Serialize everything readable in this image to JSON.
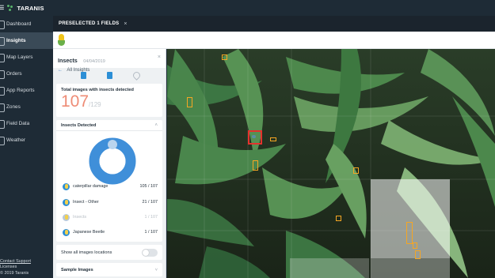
{
  "app": {
    "brand": "TARANIS"
  },
  "sidebar": {
    "items": [
      {
        "label": "Dashboard",
        "icon": "dashboard-icon"
      },
      {
        "label": "Insights",
        "icon": "insights-icon",
        "active": true
      },
      {
        "label": "Map Layers",
        "icon": "map-layers-icon"
      },
      {
        "label": "Orders",
        "icon": "orders-icon"
      },
      {
        "label": "App Reports",
        "icon": "app-reports-icon"
      },
      {
        "label": "Zones",
        "icon": "zones-icon"
      },
      {
        "label": "Field Data",
        "icon": "field-data-icon"
      },
      {
        "label": "Weather",
        "icon": "weather-icon"
      }
    ],
    "footer": {
      "contact": "Contact Support",
      "licenses": "Licenses",
      "copyright": "© 2019 Taranis"
    }
  },
  "topbar": {
    "title": "PRESELECTED 1 FIELDS",
    "close": "×"
  },
  "crop": {
    "icon": "corn-icon"
  },
  "panel": {
    "title": "Insects",
    "date": "04/04/2019",
    "close": "×",
    "back_arrow": "←",
    "back_label": "All Insights",
    "total_label": "Total images with insects detected",
    "total_value": "107",
    "total_of": "/129",
    "detected_title": "Insects Detected",
    "detected_chevron": "˄",
    "rows": [
      {
        "label": "caterpillar damage",
        "value": "105 / 107"
      },
      {
        "label": "Insect - Other",
        "value": "21 / 107"
      },
      {
        "label": "Insects",
        "value": "1 / 107"
      },
      {
        "label": "Japanese Beetle",
        "value": "1 / 107"
      }
    ],
    "toggle_label": "Show all images locations",
    "toggle_on": false,
    "sample_label": "Sample Images",
    "sample_chevron": "˅"
  },
  "colors": {
    "accent": "#2c8fd6",
    "total": "#ee8c76",
    "marker": "#f5a623",
    "selected_marker": "#e5322d",
    "sidebar": "#1e2b36"
  }
}
